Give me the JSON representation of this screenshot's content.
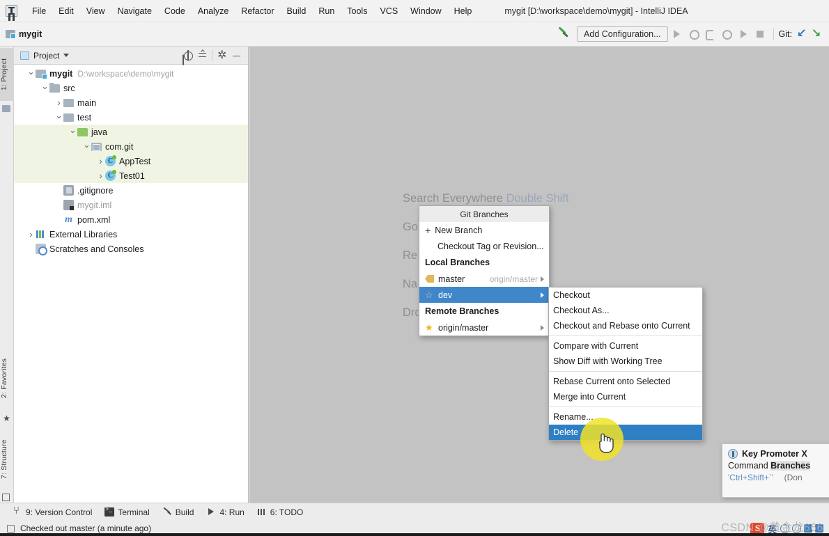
{
  "window": {
    "title": "mygit [D:\\workspace\\demo\\mygit] - IntelliJ IDEA",
    "logo_icon": "intellij-idea-logo-icon"
  },
  "menubar": {
    "items": [
      {
        "label": "File"
      },
      {
        "label": "Edit"
      },
      {
        "label": "View"
      },
      {
        "label": "Navigate"
      },
      {
        "label": "Code"
      },
      {
        "label": "Analyze"
      },
      {
        "label": "Refactor"
      },
      {
        "label": "Build"
      },
      {
        "label": "Run"
      },
      {
        "label": "Tools"
      },
      {
        "label": "VCS"
      },
      {
        "label": "Window"
      },
      {
        "label": "Help"
      }
    ]
  },
  "toolbar": {
    "breadcrumb": "mygit",
    "breadcrumb_icon": "module-icon",
    "build_icon": "hammer-icon",
    "add_configuration": "Add Configuration...",
    "icons": [
      "run-icon",
      "debug-icon",
      "run-with-coverage-icon",
      "profile-icon",
      "rerun-icon",
      "stop-icon"
    ],
    "git_label": "Git:",
    "git_icons": [
      "update-project-icon",
      "commit-icon"
    ]
  },
  "left_strip": {
    "tabs": [
      {
        "label": "1: Project",
        "icon": "project-icon",
        "active": true
      },
      {
        "label": "2: Favorites",
        "icon": "star-icon",
        "active": false
      },
      {
        "label": "7: Structure",
        "icon": "structure-icon",
        "active": false
      }
    ]
  },
  "project_panel": {
    "title": "Project",
    "title_icon": "project-view-icon",
    "tools": [
      {
        "name": "select-opened-file-icon"
      },
      {
        "name": "collapse-all-icon"
      },
      {
        "name": "settings-gear-icon"
      },
      {
        "name": "hide-icon"
      }
    ],
    "tree": [
      {
        "depth": 0,
        "arrow": "down",
        "icon": "module-folder",
        "label": "mygit",
        "bold": true,
        "path": "D:\\workspace\\demo\\mygit",
        "highlight": false
      },
      {
        "depth": 1,
        "arrow": "down",
        "icon": "source-folder",
        "label": "src",
        "bold": false,
        "path": "",
        "highlight": false
      },
      {
        "depth": 2,
        "arrow": "right",
        "icon": "folder",
        "label": "main",
        "bold": false,
        "path": "",
        "highlight": false
      },
      {
        "depth": 2,
        "arrow": "down",
        "icon": "folder",
        "label": "test",
        "bold": false,
        "path": "",
        "highlight": false
      },
      {
        "depth": 3,
        "arrow": "down",
        "icon": "test-source-folder",
        "label": "java",
        "bold": false,
        "path": "",
        "highlight": true
      },
      {
        "depth": 4,
        "arrow": "down",
        "icon": "package-folder",
        "label": "com.git",
        "bold": false,
        "path": "",
        "highlight": true
      },
      {
        "depth": 5,
        "arrow": "right",
        "icon": "java-class",
        "label": "AppTest",
        "bold": false,
        "path": "",
        "highlight": true
      },
      {
        "depth": 5,
        "arrow": "right",
        "icon": "java-class",
        "label": "Test01",
        "bold": false,
        "path": "",
        "highlight": true
      },
      {
        "depth": 2,
        "arrow": "none",
        "icon": "gitignore-file",
        "label": ".gitignore",
        "bold": false,
        "path": "",
        "highlight": false
      },
      {
        "depth": 2,
        "arrow": "none",
        "icon": "iml-file",
        "label": "mygit.iml",
        "bold": false,
        "path": "",
        "highlight": false
      },
      {
        "depth": 2,
        "arrow": "none",
        "icon": "maven-pom-file",
        "label": "pom.xml",
        "bold": false,
        "path": "",
        "highlight": false
      },
      {
        "depth": 0,
        "arrow": "right",
        "icon": "library-icon",
        "label": "External Libraries",
        "bold": false,
        "path": "",
        "highlight": false
      },
      {
        "depth": 0,
        "arrow": "none",
        "icon": "scratches-icon",
        "label": "Scratches and Consoles",
        "bold": false,
        "path": "",
        "highlight": false
      }
    ]
  },
  "editor_tips": [
    {
      "text": "Search Everywhere",
      "key": "Double Shift"
    },
    {
      "text": "Go",
      "key": ""
    },
    {
      "text": "Re",
      "key": ""
    },
    {
      "text": "Na",
      "key": ""
    },
    {
      "text": "Dro",
      "key": ""
    }
  ],
  "git_branches_popup": {
    "title": "Git Branches",
    "actions": [
      {
        "label": "New Branch",
        "icon": "plus-icon"
      },
      {
        "label": "Checkout Tag or Revision...",
        "icon": ""
      }
    ],
    "local_section": "Local Branches",
    "local_branches": [
      {
        "label": "master",
        "icon": "tag-icon",
        "tracking": "origin/master",
        "selected": false
      },
      {
        "label": "dev",
        "icon": "star-outline-icon",
        "tracking": "",
        "selected": true
      }
    ],
    "remote_section": "Remote Branches",
    "remote_branches": [
      {
        "label": "origin/master",
        "icon": "star-filled-icon",
        "tracking": "",
        "selected": false
      }
    ]
  },
  "branch_context_menu": {
    "groups": [
      {
        "items": [
          {
            "label": "Checkout",
            "selected": false
          },
          {
            "label": "Checkout As...",
            "selected": false
          },
          {
            "label": "Checkout and Rebase onto Current",
            "selected": false
          }
        ]
      },
      {
        "items": [
          {
            "label": "Compare with Current",
            "selected": false
          },
          {
            "label": "Show Diff with Working Tree",
            "selected": false
          }
        ]
      },
      {
        "items": [
          {
            "label": "Rebase Current onto Selected",
            "selected": false
          },
          {
            "label": "Merge into Current",
            "selected": false
          }
        ]
      },
      {
        "items": [
          {
            "label": "Rename...",
            "selected": false
          },
          {
            "label": "Delete",
            "selected": true
          }
        ]
      }
    ]
  },
  "key_promoter": {
    "icon": "key-promoter-icon",
    "title": "Key Promoter X",
    "command_prefix": "Command ",
    "command_name": "Branches",
    "shortcut": "'Ctrl+Shift+`'",
    "note": "(Don"
  },
  "bottom_bar": {
    "items": [
      {
        "label": "9: Version Control",
        "icon": "version-control-icon",
        "mnemonic": "9"
      },
      {
        "label": "Terminal",
        "icon": "terminal-icon",
        "mnemonic": ""
      },
      {
        "label": "Build",
        "icon": "build-icon",
        "mnemonic": ""
      },
      {
        "label": "4: Run",
        "icon": "run-icon",
        "mnemonic": "4"
      },
      {
        "label": "6: TODO",
        "icon": "todo-icon",
        "mnemonic": "6"
      }
    ]
  },
  "status_bar": {
    "icon": "event-log-icon",
    "message": "Checked out master (a minute ago)",
    "ime": {
      "logo": "S",
      "mode": "英",
      "icons": [
        "ime-keyboard-icon",
        "ime-pen-icon",
        "ime-panel-icon",
        "ime-tools-icon"
      ]
    },
    "watermark": "CSDN @黄金龙666"
  },
  "colors": {
    "selection_blue": "#3f87c8",
    "context_selection_blue": "#2f7fc4",
    "tree_highlight_green": "#eff5e2",
    "editor_bg": "#c3c3c3",
    "click_highlight_yellow": "#f0e228"
  }
}
